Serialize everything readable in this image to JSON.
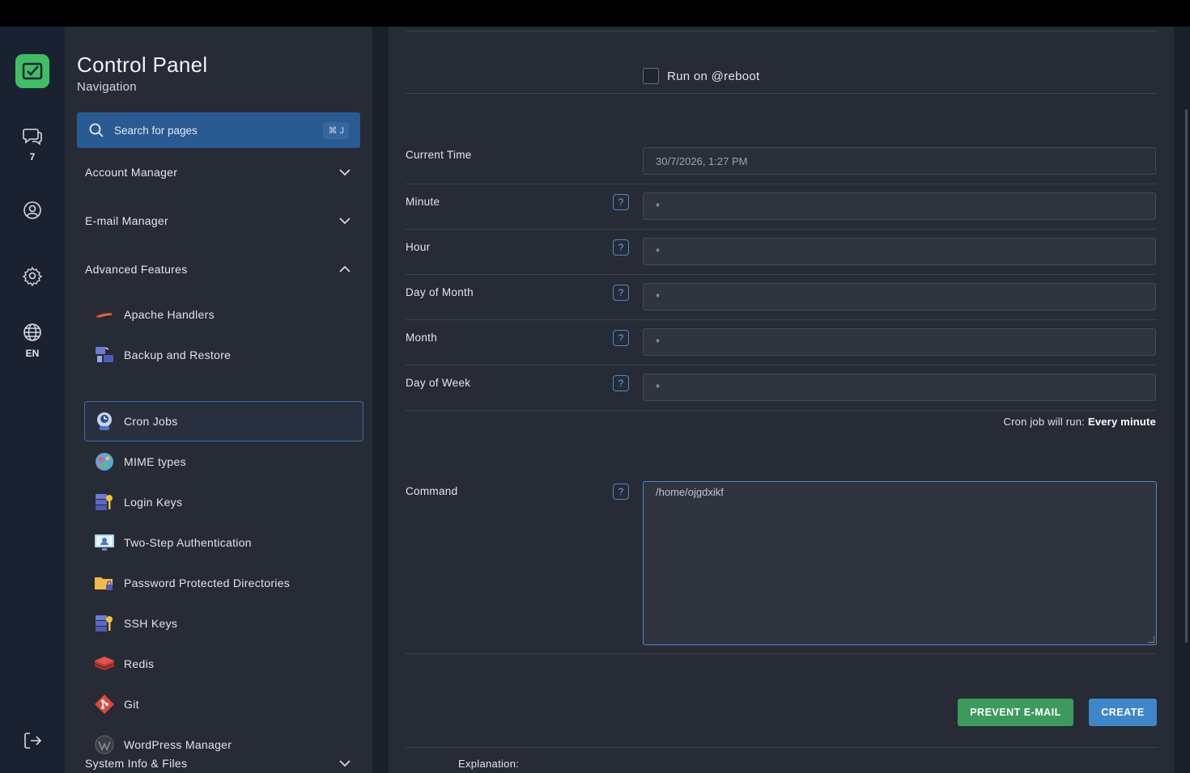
{
  "sidebar": {
    "title": "Control Panel",
    "subtitle": "Navigation",
    "search_placeholder": "Search for pages",
    "search_shortcut": "⌘ J",
    "sections": {
      "account": "Account Manager",
      "email": "E-mail Manager",
      "advanced": "Advanced Features",
      "system": "System Info & Files"
    },
    "items": [
      {
        "label": "Apache Handlers",
        "icon": "apache-icon"
      },
      {
        "label": "Backup and Restore",
        "icon": "backup-icon"
      },
      {
        "label": "Cron Jobs",
        "icon": "cron-icon"
      },
      {
        "label": "MIME types",
        "icon": "mime-icon"
      },
      {
        "label": "Login Keys",
        "icon": "login-keys-icon"
      },
      {
        "label": "Two-Step Authentication",
        "icon": "two-step-icon"
      },
      {
        "label": "Password Protected Directories",
        "icon": "folder-lock-icon"
      },
      {
        "label": "SSH Keys",
        "icon": "ssh-keys-icon"
      },
      {
        "label": "Redis",
        "icon": "redis-icon"
      },
      {
        "label": "Git",
        "icon": "git-icon"
      },
      {
        "label": "WordPress Manager",
        "icon": "wordpress-icon"
      }
    ]
  },
  "rail": {
    "messages_count": "7",
    "language": "EN"
  },
  "form": {
    "reboot_label": "Run on @reboot",
    "current_time_label": "Current Time",
    "current_time_value": "30/7/2026, 1:27 PM",
    "minute_label": "Minute",
    "minute_value": "*",
    "hour_label": "Hour",
    "hour_value": "*",
    "dom_label": "Day of Month",
    "dom_value": "*",
    "month_label": "Month",
    "month_value": "*",
    "dow_label": "Day of Week",
    "dow_value": "*",
    "run_prefix": "Cron job will run:",
    "run_value": "Every minute",
    "command_label": "Command",
    "command_value": "/home/ojgdxikf",
    "help_glyph": "?",
    "prevent_label": "PREVENT E-MAIL",
    "create_label": "CREATE",
    "explanation_label": "Explanation:"
  },
  "colors": {
    "accent_blue": "#3f86c8",
    "accent_green": "#3c9a5c",
    "logo_green": "#3fbf64"
  }
}
